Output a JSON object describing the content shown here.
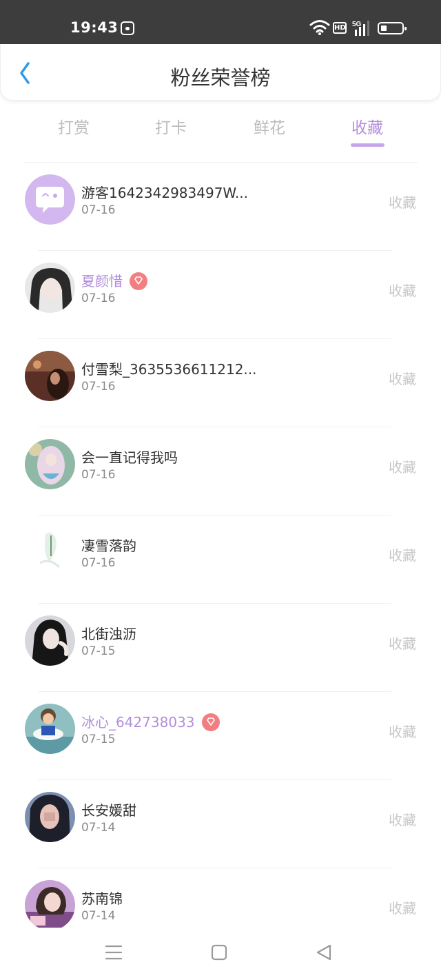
{
  "status_bar": {
    "time": "19:43",
    "hd_label": "HD",
    "network_label": "5G"
  },
  "header": {
    "title": "粉丝荣誉榜"
  },
  "tabs": [
    {
      "label": "打赏",
      "active": false
    },
    {
      "label": "打卡",
      "active": false
    },
    {
      "label": "鲜花",
      "active": false
    },
    {
      "label": "收藏",
      "active": true
    }
  ],
  "fans": [
    {
      "name": "游客1642342983497W...",
      "date": "07-16",
      "action": "收藏",
      "vip": false
    },
    {
      "name": "夏颜惜",
      "date": "07-16",
      "action": "收藏",
      "vip": true
    },
    {
      "name": "付雪梨_3635536611212...",
      "date": "07-16",
      "action": "收藏",
      "vip": false
    },
    {
      "name": "会一直记得我吗",
      "date": "07-16",
      "action": "收藏",
      "vip": false
    },
    {
      "name": "凄雪落韵",
      "date": "07-16",
      "action": "收藏",
      "vip": false
    },
    {
      "name": "北街浊沥",
      "date": "07-15",
      "action": "收藏",
      "vip": false
    },
    {
      "name": "冰心_642738033",
      "date": "07-15",
      "action": "收藏",
      "vip": true
    },
    {
      "name": "长安媛甜",
      "date": "07-14",
      "action": "收藏",
      "vip": false
    },
    {
      "name": "苏南锦",
      "date": "07-14",
      "action": "收藏",
      "vip": false
    }
  ],
  "colors": {
    "accent": "#b38fdb",
    "vip_badge": "#f37e80",
    "back_arrow": "#2f9ae8",
    "status_bar": "#3d3d3d"
  }
}
